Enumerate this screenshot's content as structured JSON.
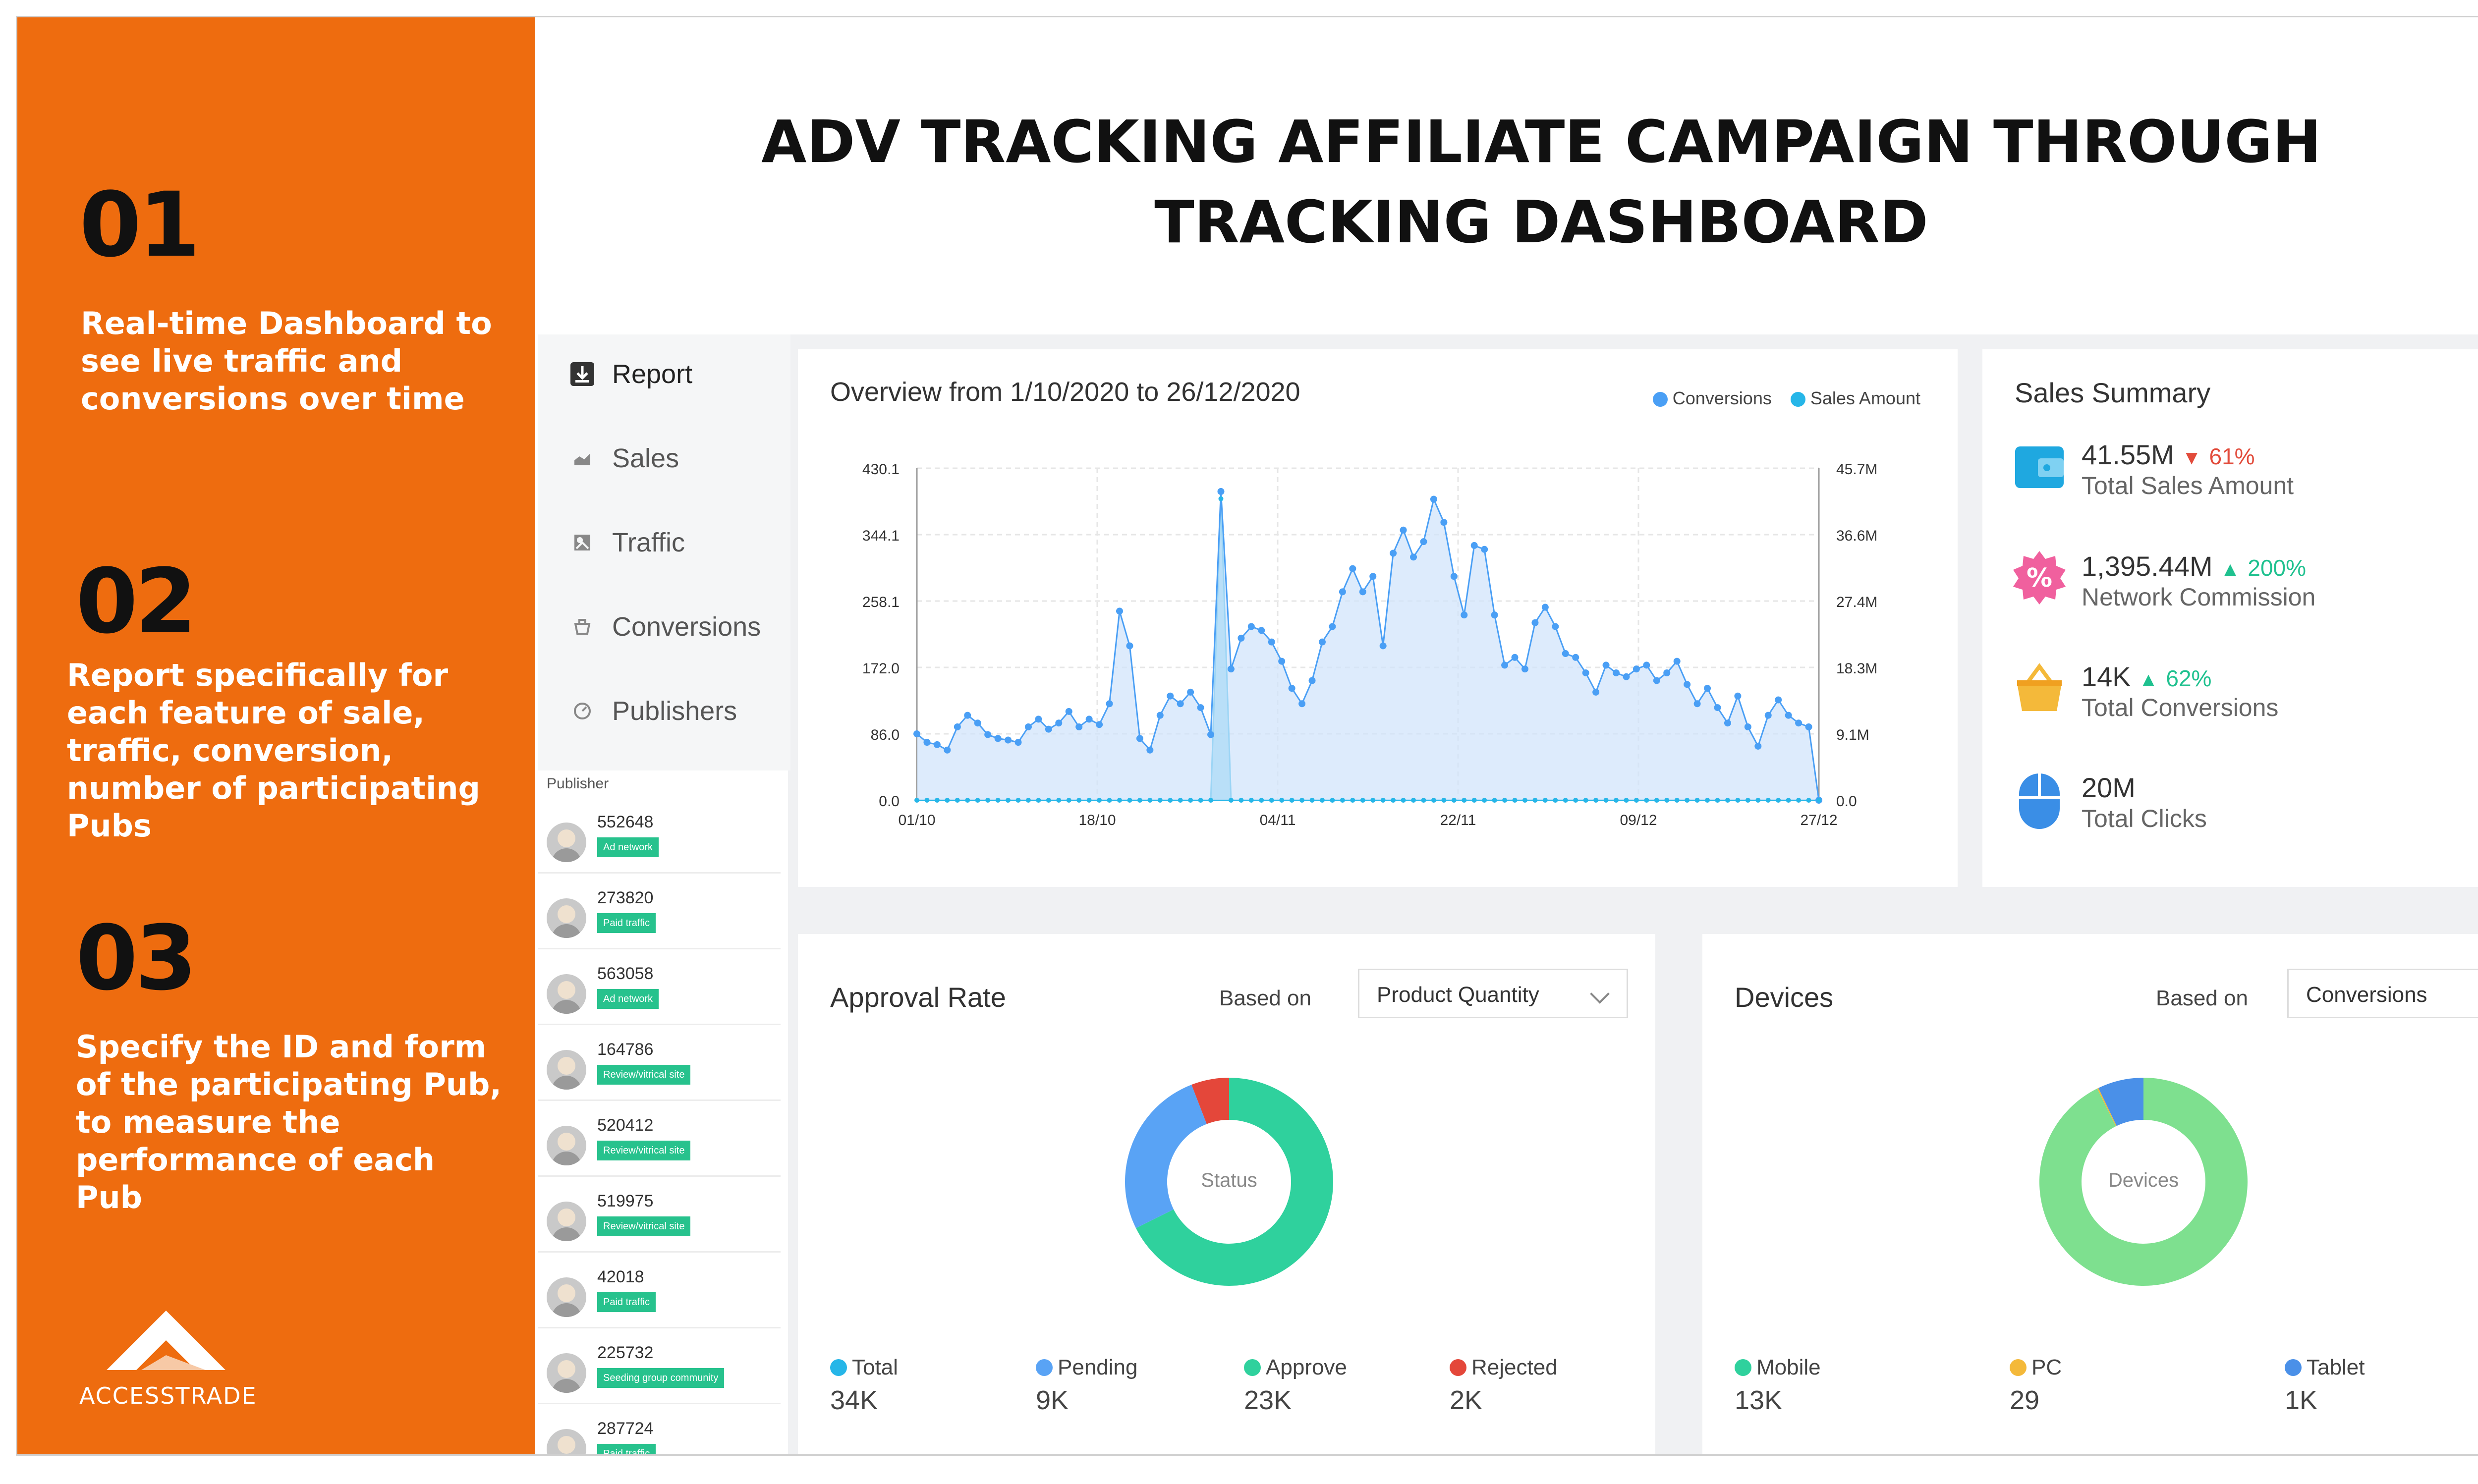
{
  "slide": {
    "title": "ADV TRACKING AFFILIATE CAMPAIGN THROUGH TRACKING DASHBOARD",
    "title_line1": "ADV TRACKING AFFILIATE CAMPAIGN THROUGH",
    "title_line2": "TRACKING DASHBOARD",
    "accent_color": "#ee6c0f"
  },
  "left_panel": {
    "points": [
      {
        "number": "01",
        "text": "Real-time Dashboard to see live traffic and conversions over time"
      },
      {
        "number": "02",
        "text": "Report specifically for each feature of sale, traffic, conversion, number of participating Pubs"
      },
      {
        "number": "03",
        "text": "Specify the ID and form of the participating Pub, to measure the performance of each Pub"
      }
    ],
    "logo_text": "ACCESSTRADE"
  },
  "menu": {
    "items": [
      {
        "label": "Report",
        "icon": "report-icon",
        "active": true
      },
      {
        "label": "Sales",
        "icon": "sales-icon",
        "active": false
      },
      {
        "label": "Traffic",
        "icon": "traffic-icon",
        "active": false
      },
      {
        "label": "Conversions",
        "icon": "conversions-icon",
        "active": false
      },
      {
        "label": "Publishers",
        "icon": "publishers-icon",
        "active": false
      }
    ]
  },
  "publishers": {
    "header": "Publisher",
    "rows": [
      {
        "id": "552648",
        "type": "Ad network"
      },
      {
        "id": "273820",
        "type": "Paid traffic"
      },
      {
        "id": "563058",
        "type": "Ad network"
      },
      {
        "id": "164786",
        "type": "Review/vitrical site"
      },
      {
        "id": "520412",
        "type": "Review/vitrical site"
      },
      {
        "id": "519975",
        "type": "Review/vitrical site"
      },
      {
        "id": "42018",
        "type": "Paid traffic"
      },
      {
        "id": "225732",
        "type": "Seeding group community"
      },
      {
        "id": "287724",
        "type": "Paid traffic"
      }
    ]
  },
  "overview": {
    "title": "Overview from 1/10/2020 to 26/12/2020",
    "legend": [
      {
        "label": "Conversions",
        "color": "#4a9ff5"
      },
      {
        "label": "Sales Amount",
        "color": "#26b6e8"
      }
    ]
  },
  "chart_data": {
    "type": "line",
    "title": "Overview from 1/10/2020 to 26/12/2020",
    "x_ticks": [
      "01/10",
      "18/10",
      "04/11",
      "22/11",
      "09/12",
      "27/12"
    ],
    "y_left_ticks": [
      "430.1",
      "344.1",
      "258.1",
      "172.0",
      "86.0",
      "0.0"
    ],
    "y_right_ticks": [
      "45.7M",
      "36.6M",
      "27.4M",
      "18.3M",
      "9.1M",
      "0.0"
    ],
    "ylim": [
      0,
      430.1
    ],
    "y2lim": [
      0,
      45.7
    ],
    "grid": true,
    "legend_position": "top-right",
    "series": [
      {
        "name": "Conversions",
        "color": "#4a9ff5",
        "values": [
          86,
          75,
          72,
          65,
          95,
          110,
          100,
          85,
          80,
          78,
          75,
          95,
          105,
          92,
          100,
          115,
          95,
          105,
          98,
          125,
          245,
          200,
          80,
          65,
          110,
          135,
          125,
          140,
          120,
          85,
          400,
          170,
          210,
          225,
          220,
          205,
          180,
          145,
          125,
          155,
          205,
          225,
          270,
          300,
          270,
          290,
          200,
          320,
          350,
          315,
          335,
          390,
          360,
          290,
          240,
          330,
          325,
          240,
          175,
          185,
          170,
          230,
          250,
          225,
          190,
          185,
          165,
          140,
          175,
          165,
          160,
          170,
          175,
          155,
          165,
          180,
          150,
          125,
          145,
          120,
          100,
          135,
          95,
          70,
          110,
          130,
          110,
          100,
          95,
          0
        ]
      },
      {
        "name": "Sales Amount",
        "color": "#26b6e8",
        "values": [
          0,
          0,
          0,
          0,
          0,
          0,
          0,
          0,
          0,
          0,
          0,
          0,
          0,
          0,
          0,
          0,
          0,
          0,
          0,
          0,
          0,
          0,
          0,
          0,
          0,
          0,
          0,
          0,
          0,
          0,
          41.5,
          0,
          0,
          0,
          0,
          0,
          0,
          0,
          0,
          0,
          0,
          0,
          0,
          0,
          0,
          0,
          0,
          0,
          0,
          0,
          0,
          0,
          0,
          0,
          0,
          0,
          0,
          0,
          0,
          0,
          0,
          0,
          0,
          0,
          0,
          0,
          0,
          0,
          0,
          0,
          0,
          0,
          0,
          0,
          0,
          0,
          0,
          0,
          0,
          0,
          0,
          0,
          0,
          0,
          0,
          0,
          0,
          0,
          0,
          0
        ]
      }
    ]
  },
  "sales_summary": {
    "title": "Sales Summary",
    "items": [
      {
        "value": "41.55M",
        "change": "61%",
        "direction": "down",
        "label": "Total Sales Amount",
        "icon": "wallet-icon",
        "icon_color": "#1fa8e0"
      },
      {
        "value": "1,395.44M",
        "change": "200%",
        "direction": "up",
        "label": "Network Commission",
        "icon": "percent-badge-icon",
        "icon_color": "#f0609e"
      },
      {
        "value": "14K",
        "change": "62%",
        "direction": "up",
        "label": "Total Conversions",
        "icon": "basket-icon",
        "icon_color": "#f4b93a"
      },
      {
        "value": "20M",
        "change": "",
        "direction": "",
        "label": "Total Clicks",
        "icon": "mouse-icon",
        "icon_color": "#3a8ee6"
      }
    ],
    "up_color": "#1fc18f",
    "down_color": "#e24b3b"
  },
  "approval": {
    "title": "Approval Rate",
    "based_on_label": "Based on",
    "select_value": "Product Quantity",
    "donut_label": "Status",
    "slices": [
      {
        "name": "Approve",
        "value": 23,
        "color": "#2fd19d"
      },
      {
        "name": "Pending",
        "value": 9,
        "color": "#59a3f5"
      },
      {
        "name": "Rejected",
        "value": 2,
        "color": "#e4473a"
      }
    ],
    "legend": [
      {
        "name": "Total",
        "value": "34K",
        "color": "#26b6e8"
      },
      {
        "name": "Pending",
        "value": "9K",
        "color": "#59a3f5"
      },
      {
        "name": "Approve",
        "value": "23K",
        "color": "#2fd19d"
      },
      {
        "name": "Rejected",
        "value": "2K",
        "color": "#e4473a"
      }
    ]
  },
  "devices": {
    "title": "Devices",
    "based_on_label": "Based on",
    "select_value": "Conversions",
    "donut_label": "Devices",
    "slices": [
      {
        "name": "Mobile",
        "value": 13,
        "color": "#7ee08f"
      },
      {
        "name": "PC",
        "value": 0.029,
        "color": "#f4b93a"
      },
      {
        "name": "Tablet",
        "value": 1,
        "color": "#4a90e8"
      }
    ],
    "legend": [
      {
        "name": "Mobile",
        "value": "13K",
        "color": "#2fd19d"
      },
      {
        "name": "PC",
        "value": "29",
        "color": "#f4b93a"
      },
      {
        "name": "Tablet",
        "value": "1K",
        "color": "#4a90e8"
      }
    ]
  }
}
